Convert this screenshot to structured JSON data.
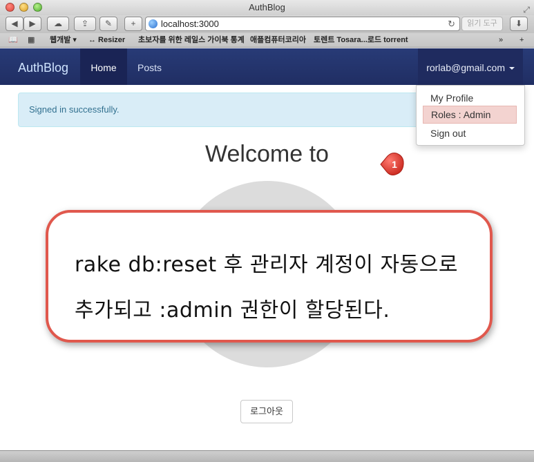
{
  "window": {
    "title": "AuthBlog"
  },
  "toolbar": {
    "url": "localhost:3000",
    "reader_label": "읽기 도구",
    "new_tab_label": "+"
  },
  "bookmarks": {
    "items": [
      "웹개발 ▾",
      "↔ Resizer",
      "초보자를 위한 레일스 가이북 통계",
      "애플컴퓨터코리아",
      "토렌트 Tosara...로드 torrent"
    ]
  },
  "navbar": {
    "brand": "AuthBlog",
    "home_label": "Home",
    "posts_label": "Posts",
    "user_email": "rorlab@gmail.com"
  },
  "alert": {
    "message": "Signed in successfully."
  },
  "dropdown": {
    "items": [
      "My Profile",
      "Roles : Admin",
      "Sign out"
    ]
  },
  "badge": {
    "number": "1",
    "color": "#e53b30"
  },
  "main": {
    "welcome": "Welcome to",
    "logout_label": "로그아웃"
  },
  "callout": {
    "line1": "rake db:reset 후 관리자 계정이 자동으로",
    "line2": "추가되고 :admin 권한이 할당된다."
  }
}
